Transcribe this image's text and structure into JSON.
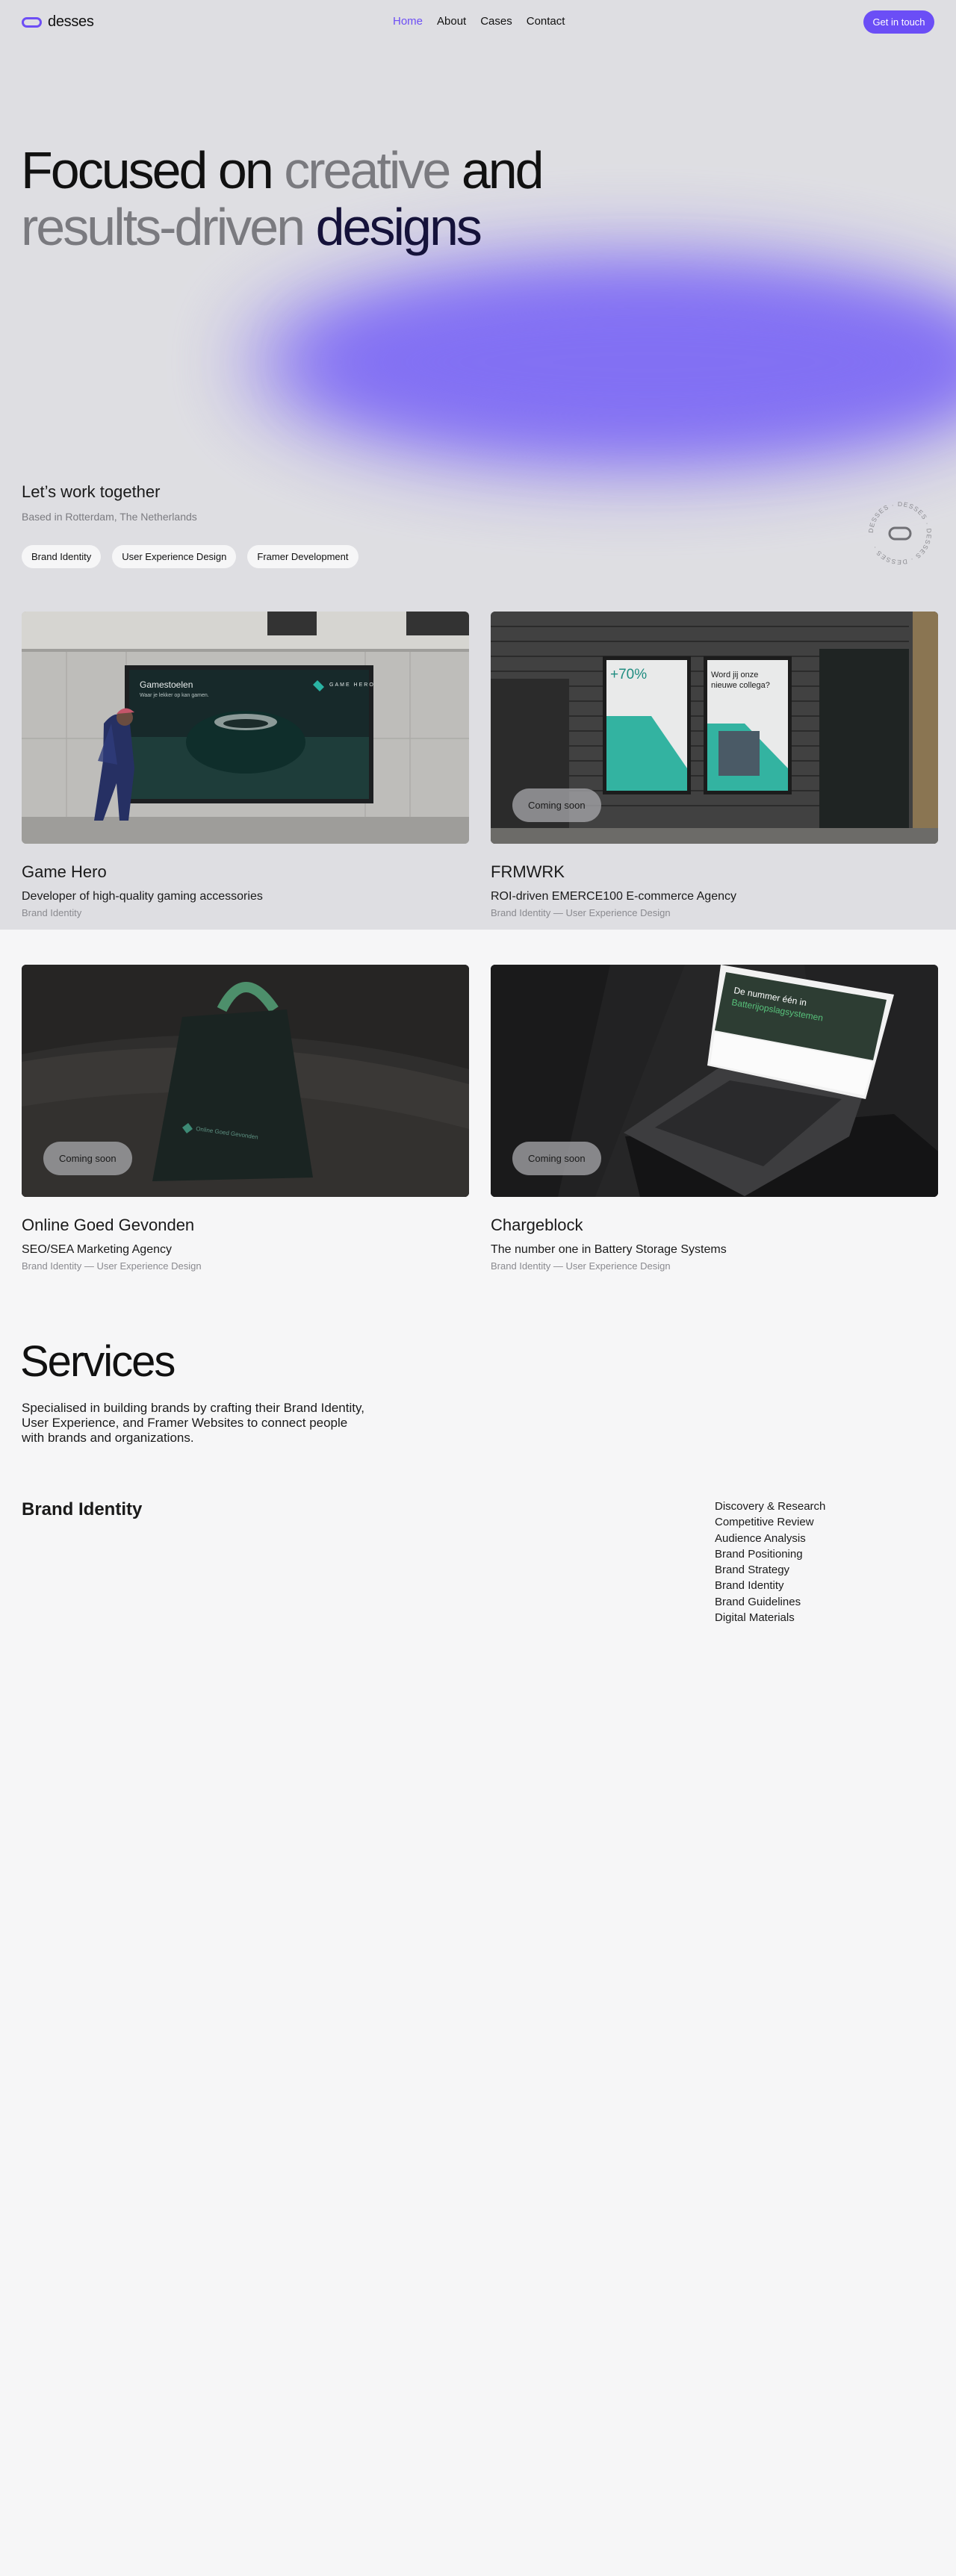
{
  "nav": {
    "logo_text": "desses",
    "links": [
      "Home",
      "About",
      "Cases",
      "Contact"
    ],
    "active": "Home",
    "cta": "Get in touch"
  },
  "hero": {
    "line1_a": "Focused on",
    "line1_b": "creative",
    "line1_c": "and",
    "line2_a": "results-driven",
    "line2_b": "designs",
    "accent_color": "#6b4ef6"
  },
  "intro": {
    "heading": "Let’s work together",
    "location": "Based in Rotterdam, The Netherlands",
    "tags": [
      "Brand Identity",
      "User Experience Design",
      "Framer Development"
    ],
    "badge_text": "DESSES · DESSES · DESSES · DESSES ·"
  },
  "projects": [
    {
      "name": "Game Hero",
      "description": "Developer of high-quality gaming accessories",
      "category": "Brand Identity",
      "status": "",
      "billboard_title": "Gamestoelen",
      "billboard_sub": "Waar je lekker op kan gamen.",
      "billboard_brand": "GAME HERO"
    },
    {
      "name": "FRMWRK",
      "description": "ROI-driven EMERCE100 E-commerce Agency",
      "category": "Brand Identity — User Experience Design",
      "status": "Coming soon",
      "poster1_stat": "+70%",
      "poster2_title": "Word jij onze nieuwe collega?"
    },
    {
      "name": "Online Goed Gevonden",
      "description": "SEO/SEA Marketing Agency",
      "category": "Brand Identity — User Experience Design",
      "status": "Coming soon",
      "bag_brand": "Online Goed Gevonden"
    },
    {
      "name": "Chargeblock",
      "description": "The number one in Battery Storage Systems",
      "category": "Brand Identity — User Experience Design",
      "status": "Coming soon",
      "screen_line1": "De nummer één in",
      "screen_line2": "Batterijopslagsystemen"
    }
  ],
  "services": {
    "title": "Services",
    "description": "Specialised in building brands by crafting their Brand Identity, User Experience, and Framer Websites to connect people with brands and organizations.",
    "category": "Brand Identity",
    "items": [
      "Discovery & Research",
      "Competitive Review",
      "Audience Analysis",
      "Brand Positioning",
      "Brand Strategy",
      "Brand Identity",
      "Brand Guidelines",
      "Digital Materials"
    ]
  }
}
